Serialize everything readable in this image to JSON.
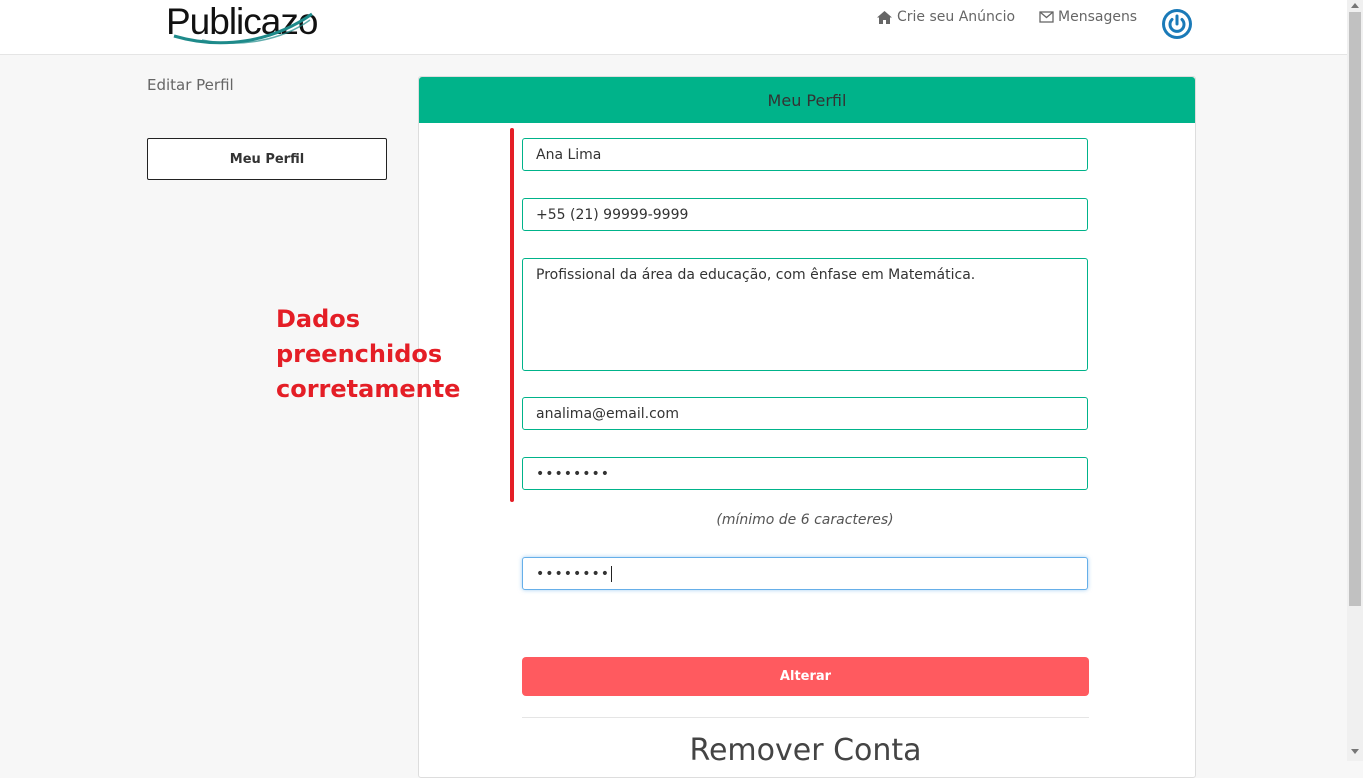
{
  "brand": {
    "logo_text": "Publicazo",
    "accent": "#00b38a",
    "swoosh_color": "#1e8a8a"
  },
  "nav": {
    "create_ad_label": "Crie seu Anúncio",
    "create_ad_icon": "home-icon",
    "messages_label": "Mensagens",
    "messages_icon": "envelope-icon",
    "power_icon": "power-icon",
    "power_color": "#1a7ab8"
  },
  "sidebar": {
    "title": "Editar Perfil",
    "button_label": "Meu Perfil"
  },
  "panel": {
    "header": "Meu Perfil",
    "header_color": "#00b38a",
    "fields": {
      "name": "Ana Lima",
      "phone": "+55 (21) 99999-9999",
      "bio": "Profissional da área da educação, com ênfase em Matemática.",
      "email": "analima@email.com",
      "password": "••••••••",
      "password_confirm": "••••••••"
    },
    "password_hint": "(mínimo de 6 caracteres)",
    "submit_label": "Alterar",
    "submit_color": "#ff5a5f",
    "remove_title": "Remover Conta"
  },
  "annotation": {
    "line1": "Dados preenchidos",
    "line2": "corretamente",
    "color": "#e41e26"
  }
}
